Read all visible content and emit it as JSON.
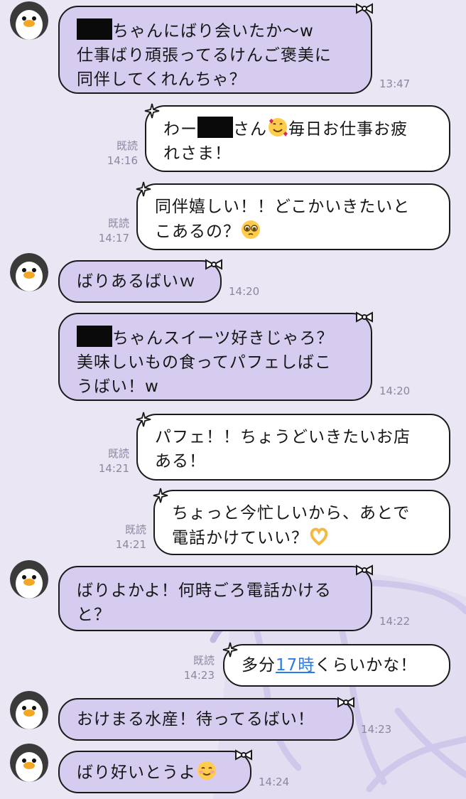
{
  "messages": [
    {
      "side": "in",
      "lines": [
        "[REDACT]ちゃんにばり会いたか〜w",
        "仕事ばり頑張ってるけんご褒美に",
        "同伴してくれんちゃ？"
      ],
      "time": "13:47"
    },
    {
      "side": "out",
      "read": "既読",
      "time": "14:16",
      "lines": [
        "わー[REDACT]さん[EMOJI:smiling-hearts]毎日お仕事お疲",
        "れさま！"
      ]
    },
    {
      "side": "out",
      "read": "既読",
      "time": "14:17",
      "lines": [
        "同伴嬉しい！！どこかいきたいと",
        "こあるの？[EMOJI:pleading]"
      ]
    },
    {
      "side": "in",
      "lines": [
        "ばりあるばいｗ"
      ],
      "time": "14:20"
    },
    {
      "side": "in",
      "lines": [
        "[REDACT]ちゃんスイーツ好きじゃろ？",
        "美味しいもの食ってパフェしばこ",
        "うばい！w"
      ],
      "time": "14:20"
    },
    {
      "side": "out",
      "read": "既読",
      "time": "14:21",
      "lines": [
        "パフェ！！ちょうどいきたいお店",
        "ある！"
      ]
    },
    {
      "side": "out",
      "read": "既読",
      "time": "14:21",
      "lines": [
        "ちょっと今忙しいから、あとで",
        "電話かけていい？[EMOJI:heart-hands]"
      ]
    },
    {
      "side": "in",
      "lines": [
        "ばりよかよ！何時ごろ電話かける",
        "と？"
      ],
      "time": "14:22"
    },
    {
      "side": "out",
      "read": "既読",
      "time": "14:23",
      "pre": "多分",
      "link": "17時",
      "post": "くらいかな！"
    },
    {
      "side": "in",
      "lines": [
        "おけまる水産！待ってるばい！"
      ],
      "time": "14:23"
    },
    {
      "side": "in",
      "lines": [
        "ばり好いとうよ[EMOJI:smiling-blush]"
      ],
      "time": "14:24"
    }
  ],
  "icons": {
    "avatar": "penguin-avatar",
    "incoming_decoration": "bow-icon",
    "outgoing_decoration": "sparkle-icon",
    "redaction": "black-redaction-bar"
  },
  "colors": {
    "background": "#ebe6f4",
    "incoming_bubble": "#d6ccf0",
    "outgoing_bubble": "#ffffff",
    "link": "#2d7be8",
    "meta": "#8c86a0"
  }
}
